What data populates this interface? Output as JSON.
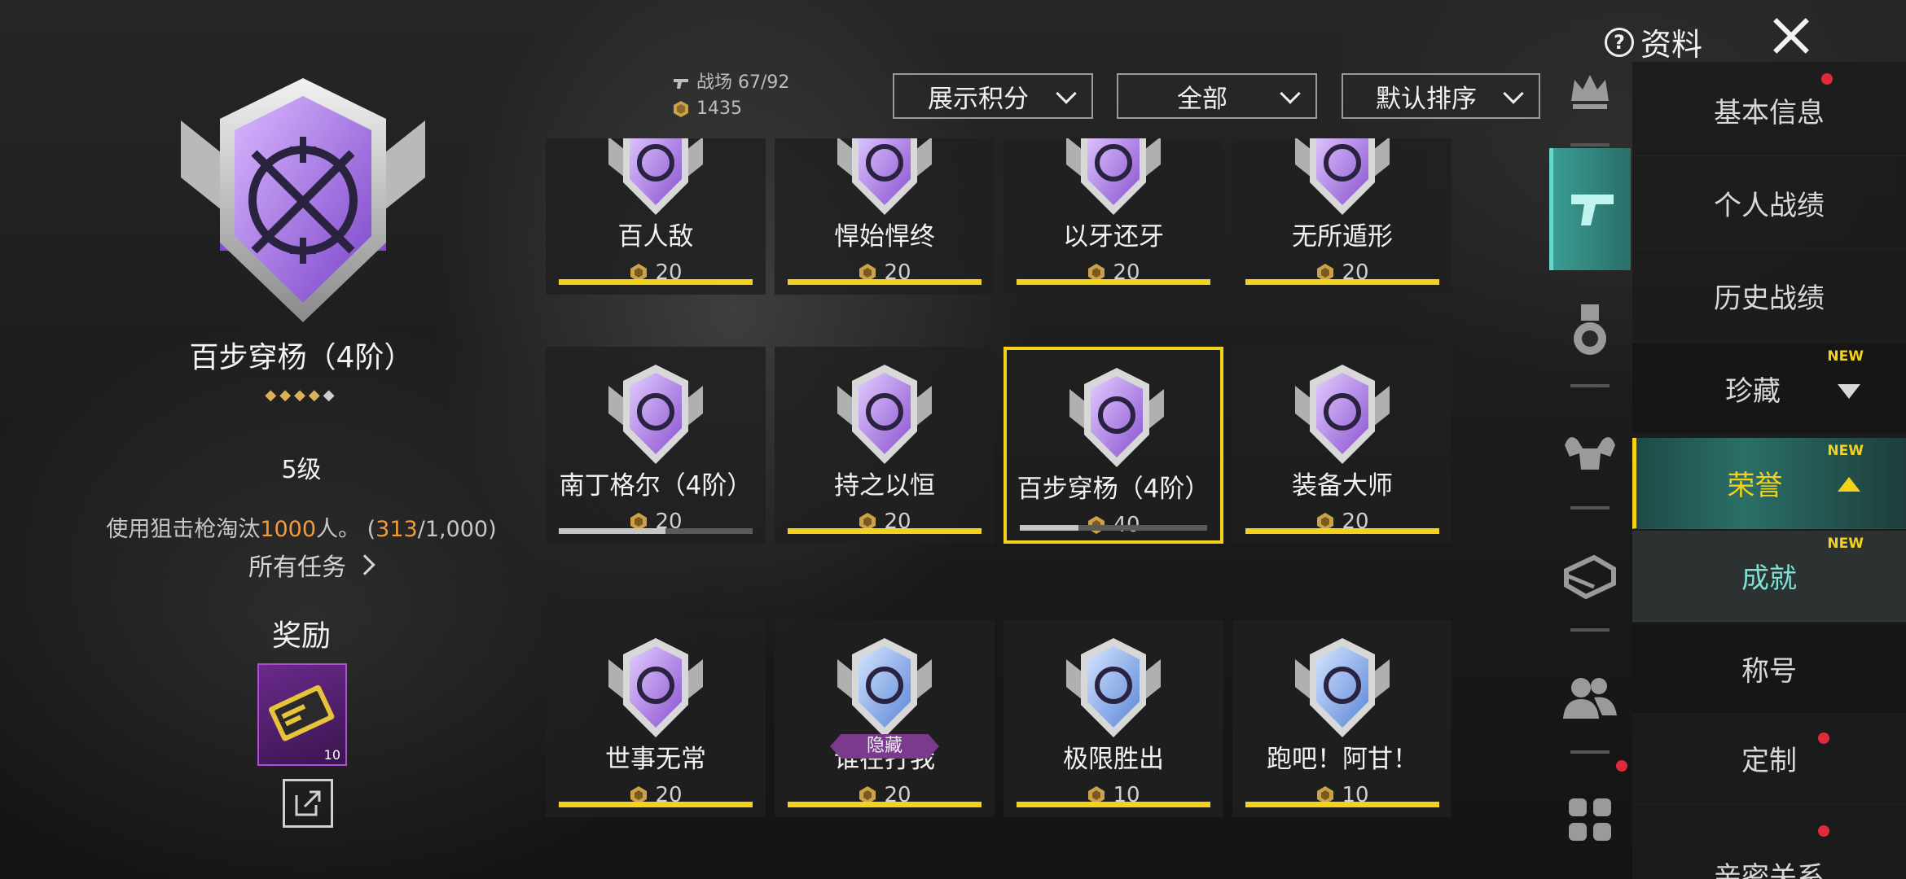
{
  "header": {
    "help_label": "资料"
  },
  "selected": {
    "name": "百步穿杨（4阶）",
    "stars_filled": "◆◆◆◆",
    "stars_empty": "◆",
    "level": "5级",
    "task_prefix": "使用狙击枪淘汰",
    "task_highlight": "1000",
    "task_suffix": "人。 (",
    "progress_current": "313",
    "progress_total": "/1,000)",
    "all_tasks_label": "所有任务",
    "reward_title": "奖励",
    "reward_count": "10"
  },
  "stats": {
    "battlefield": "战场  67/92",
    "points": "1435"
  },
  "filters": [
    {
      "label": "展示积分"
    },
    {
      "label": "全部"
    },
    {
      "label": "默认排序"
    }
  ],
  "achievements": [
    {
      "name": "百人敌",
      "points": "20",
      "progress": 1.0
    },
    {
      "name": "悍始悍终",
      "points": "20",
      "progress": 1.0
    },
    {
      "name": "以牙还牙",
      "points": "20",
      "progress": 1.0
    },
    {
      "name": "无所遁形",
      "points": "20",
      "progress": 1.0
    },
    {
      "name": "南丁格尔（4阶）",
      "points": "20",
      "progress": 0.55
    },
    {
      "name": "持之以恒",
      "points": "20",
      "progress": 1.0
    },
    {
      "name": "百步穿杨（4阶）",
      "points": "40",
      "progress": 0.313
    },
    {
      "name": "装备大师",
      "points": "20",
      "progress": 1.0
    },
    {
      "name": "世事无常",
      "points": "20",
      "progress": 1.0
    },
    {
      "name": "谁在打我",
      "points": "20",
      "progress": 1.0,
      "tag": "隐藏"
    },
    {
      "name": "极限胜出",
      "points": "10",
      "progress": 1.0
    },
    {
      "name": "跑吧！阿甘！",
      "points": "10",
      "progress": 1.0
    }
  ],
  "menu": {
    "items": [
      {
        "label": "基本信息"
      },
      {
        "label": "个人战绩"
      },
      {
        "label": "历史战绩"
      },
      {
        "label": "珍藏",
        "new": "NEW"
      },
      {
        "label": "荣誉",
        "new": "NEW"
      },
      {
        "label": "成就",
        "new": "NEW"
      },
      {
        "label": "称号"
      },
      {
        "label": "定制"
      },
      {
        "label": "亲密关系"
      }
    ]
  },
  "colors": {
    "accent_yellow": "#f4d21c",
    "accent_teal": "#3a9c92",
    "badge_purple": "#b07ae0",
    "notify_red": "#e02a3a"
  }
}
